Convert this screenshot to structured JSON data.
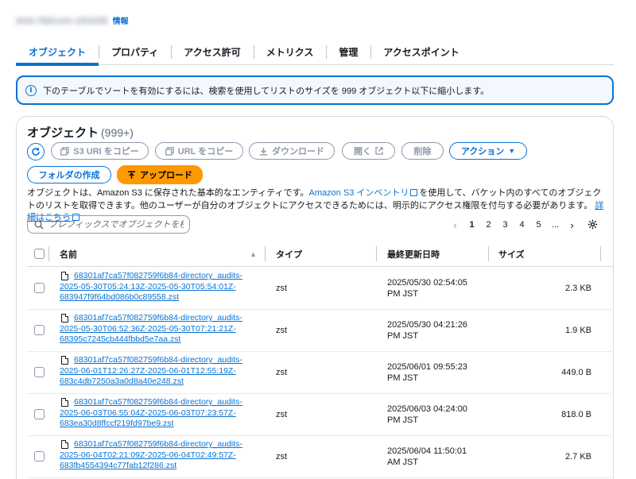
{
  "header": {
    "bucket_name": "mm-falcon-shield",
    "info_label": "情報"
  },
  "tabs": [
    {
      "label": "オブジェクト",
      "active": true
    },
    {
      "label": "プロパティ"
    },
    {
      "label": "アクセス許可"
    },
    {
      "label": "メトリクス"
    },
    {
      "label": "管理"
    },
    {
      "label": "アクセスポイント"
    }
  ],
  "alert": {
    "icon": "info-icon",
    "text": "下のテーブルでソートを有効にするには、検索を使用してリストのサイズを 999 オブジェクト以下に縮小します。"
  },
  "objects": {
    "title": "オブジェクト",
    "count": "(999+)",
    "description_1": "オブジェクトは、Amazon S3 に保存された基本的なエンティティです。",
    "inventory_link": "Amazon S3 インベントリ",
    "description_2": "を使用して、バケット内のすべてのオブジェクトのリストを取得できます。他のユーザーが自分のオブジェクトにアクセスできるためには、明示的にアクセス権限を付与する必要があります。",
    "learn_more": "詳細はこちら"
  },
  "toolbar": {
    "refresh_icon": "refresh-icon",
    "copy_s3_uri": "S3 URI をコピー",
    "copy_url": "URL をコピー",
    "download": "ダウンロード",
    "open": "開く",
    "delete": "削除",
    "actions": "アクション",
    "create_folder": "フォルダの作成",
    "upload": "アップロード"
  },
  "search": {
    "placeholder": "プレフィックスでオブジェクトを検"
  },
  "pagination": {
    "pages": [
      "1",
      "2",
      "3",
      "4",
      "5",
      "..."
    ],
    "current": "1"
  },
  "table": {
    "columns": {
      "name": "名前",
      "type": "タイプ",
      "modified": "最終更新日時",
      "size": "サイズ"
    },
    "rows": [
      {
        "name": "68301af7ca57f082759f6b84-directory_audits-2025-05-30T05:24:13Z-2025-05-30T05:54:01Z-683947f9f64bd086b0c89558.zst",
        "type": "zst",
        "date_1": "2025/05/30 02:54:05",
        "date_2": "PM JST",
        "size": "2.3 KB"
      },
      {
        "name": "68301af7ca57f082759f6b84-directory_audits-2025-05-30T06:52:36Z-2025-05-30T07:21:21Z-68395c7245cb444fbbd5e7aa.zst",
        "type": "zst",
        "date_1": "2025/05/30 04:21:26",
        "date_2": "PM JST",
        "size": "1.9 KB"
      },
      {
        "name": "68301af7ca57f082759f6b84-directory_audits-2025-06-01T12:26:27Z-2025-06-01T12:55:19Z-683c4db7250a3a0d8a40e248.zst",
        "type": "zst",
        "date_1": "2025/06/01 09:55:23",
        "date_2": "PM JST",
        "size": "449.0 B"
      },
      {
        "name": "68301af7ca57f082759f6b84-directory_audits-2025-06-03T06:55:04Z-2025-06-03T07:23:57Z-683ea30d8ffccf219fd97be9.zst",
        "type": "zst",
        "date_1": "2025/06/03 04:24:00",
        "date_2": "PM JST",
        "size": "818.0 B"
      },
      {
        "name": "68301af7ca57f082759f6b84-directory_audits-2025-06-04T02:21:09Z-2025-06-04T02:49:57Z-683fb4554394c77fab12f286.zst",
        "type": "zst",
        "date_1": "2025/06/04 11:50:01",
        "date_2": "AM JST",
        "size": "2.7 KB"
      }
    ]
  }
}
